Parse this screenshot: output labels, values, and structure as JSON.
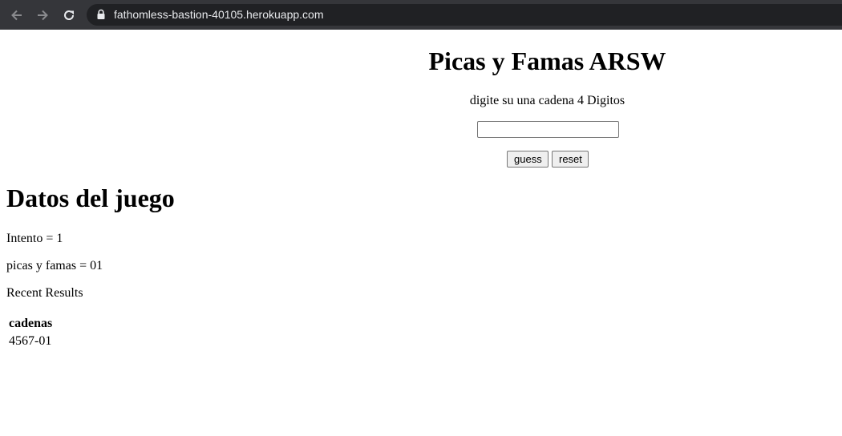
{
  "browser": {
    "url": "fathomless-bastion-40105.herokuapp.com",
    "icons": {
      "back": "arrow-left-icon",
      "forward": "arrow-right-icon",
      "reload": "reload-icon",
      "lock": "lock-icon"
    }
  },
  "game": {
    "title": "Picas y Famas ARSW",
    "prompt": "digite su una cadena 4 Digitos",
    "input_value": "",
    "guess_label": "guess",
    "reset_label": "reset"
  },
  "stats": {
    "heading": "Datos del juego",
    "attempt": "Intento = 1",
    "score": "picas y famas = 01",
    "recent_label": "Recent Results"
  },
  "results": {
    "header": "cadenas",
    "rows": [
      "4567-01"
    ]
  },
  "colors": {
    "chrome_bar": "#35363a",
    "address_bar": "#202124",
    "url_text": "#e8eaed",
    "button_bg": "#efefef"
  }
}
